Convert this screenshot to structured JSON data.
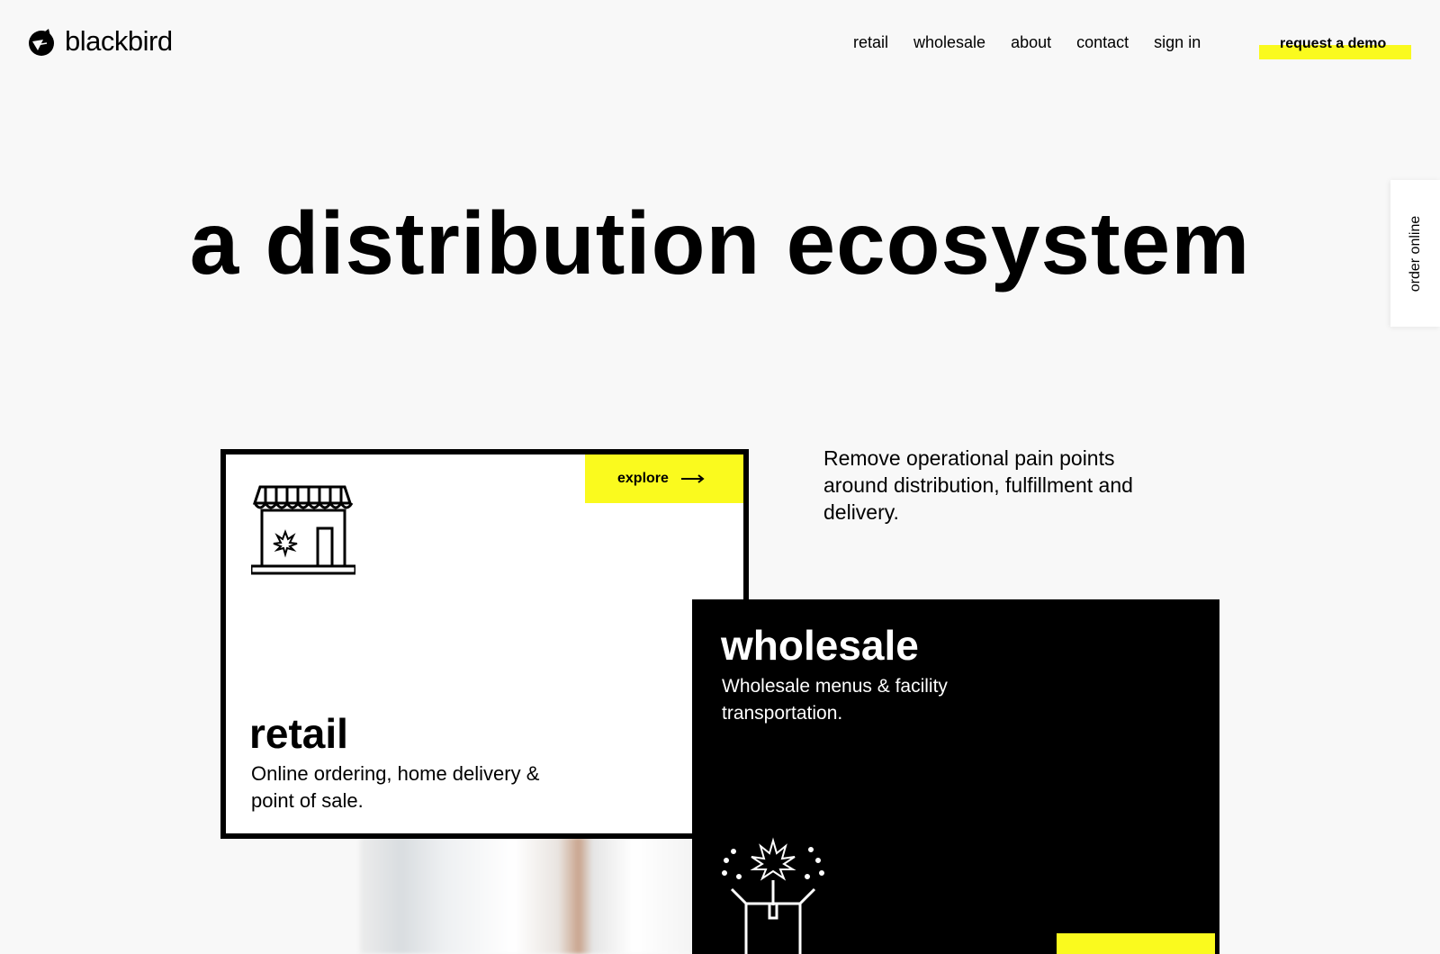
{
  "brand": {
    "name": "blackbird",
    "accent": "#fafa1e"
  },
  "nav": {
    "items": [
      "retail",
      "wholesale",
      "about",
      "contact",
      "sign in"
    ],
    "cta_label": "request a demo"
  },
  "side_tab": {
    "label": "order online"
  },
  "hero": {
    "title": "a distribution ecosystem"
  },
  "intro": {
    "text": "Remove operational pain points around distribution, fulfillment and delivery."
  },
  "retail_card": {
    "explore_label": "explore",
    "icon": "storefront-icon",
    "title": "retail",
    "description": "Online ordering, home delivery & point of sale."
  },
  "wholesale_card": {
    "icon": "open-box-icon",
    "title": "wholesale",
    "description": "Wholesale menus & facility transportation."
  }
}
